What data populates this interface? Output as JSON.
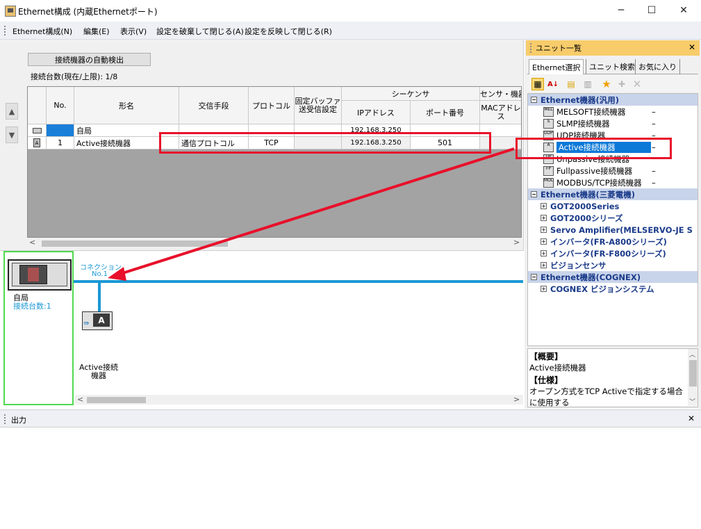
{
  "window": {
    "title": "Ethernet構成 (内蔵Ethernetポート)",
    "minimize": "─",
    "maximize": "☐",
    "close": "✕"
  },
  "menu": {
    "items": [
      "Ethernet構成(N)",
      "編集(E)",
      "表示(V)",
      "設定を破棄して閉じる(A)",
      "設定を反映して閉じる(R)"
    ]
  },
  "left": {
    "autodetect_label": "接続機器の自動検出",
    "count_label": "接続台数(現在/上限): 1/8",
    "up_arrow": "▲",
    "down_arrow": "▼",
    "table": {
      "headers": {
        "no": "No.",
        "model": "形名",
        "comm": "交信手段",
        "protocol": "プロトコル",
        "fixed_buffer_1": "固定バッファ",
        "fixed_buffer_2": "送受信設定",
        "sequencer": "シーケンサ",
        "sensor": "センサ・機器",
        "ip": "IPアドレス",
        "port": "ポート番号",
        "mac_1": "MACアドレ",
        "mac_2": "ス"
      },
      "rows": [
        {
          "no": "",
          "model": "自局",
          "comm": "",
          "protocol": "",
          "fixed": "",
          "ip": "192.168.3.250",
          "port": "",
          "mac": ""
        },
        {
          "no": "1",
          "model": "Active接続機器",
          "comm": "通信プロトコル",
          "protocol": "TCP",
          "fixed": "",
          "ip": "192.168.3.250",
          "port": "501",
          "mac": ""
        }
      ]
    },
    "scroll_left": "<",
    "scroll_right": ">"
  },
  "diagram": {
    "self_name": "自局",
    "self_count": "接続台数:1",
    "connection_label": "コネクション",
    "connection_no": "No.1",
    "device_label_1": "Active接続",
    "device_label_2": "機器",
    "device_letter": "A",
    "scroll_left": "<",
    "scroll_right": ">"
  },
  "unit_list": {
    "title": "ユニット一覧",
    "close": "✕",
    "tabs": [
      "Ethernet選択",
      "ユニット検索",
      "お気に入り"
    ],
    "tree": [
      {
        "type": "cat",
        "label": "Ethernet機器(汎用)",
        "expander": "⊟"
      },
      {
        "type": "dev",
        "icon": "MEL",
        "label": "MELSOFT接続機器",
        "dash": "–"
      },
      {
        "type": "dev",
        "icon": "S",
        "label": "SLMP接続機器",
        "dash": "–"
      },
      {
        "type": "dev",
        "icon": "UDP",
        "label": "UDP接続機器",
        "dash": "–"
      },
      {
        "type": "dev",
        "icon": "A",
        "label": "Active接続機器",
        "dash": "–",
        "selected": true
      },
      {
        "type": "dev",
        "icon": "UP",
        "label": "Unpassive接続機器",
        "dash": ""
      },
      {
        "type": "dev",
        "icon": "FP",
        "label": "Fullpassive接続機器",
        "dash": "–"
      },
      {
        "type": "dev",
        "icon": "MOD",
        "label": "MODBUS/TCP接続機器",
        "dash": "–"
      },
      {
        "type": "cat",
        "label": "Ethernet機器(三菱電機)",
        "expander": "⊟"
      },
      {
        "type": "sub",
        "label": "GOT2000Series",
        "expander": "⊞"
      },
      {
        "type": "sub",
        "label": "GOT2000シリーズ",
        "expander": "⊞"
      },
      {
        "type": "sub",
        "label": "Servo Amplifier(MELSERVO-JE S",
        "expander": "⊞"
      },
      {
        "type": "sub",
        "label": "インバータ(FR-A800シリーズ)",
        "expander": "⊞"
      },
      {
        "type": "sub",
        "label": "インバータ(FR-F800シリーズ)",
        "expander": "⊞"
      },
      {
        "type": "sub",
        "label": "ビジョンセンサ",
        "expander": "⊞"
      },
      {
        "type": "cat",
        "label": "Ethernet機器(COGNEX)",
        "expander": "⊟"
      },
      {
        "type": "sub",
        "label": "COGNEX ビジョンシステム",
        "expander": "⊞"
      }
    ],
    "desc": {
      "summary_head": "【概要】",
      "summary": "Active接続機器",
      "spec_head": "【仕様】",
      "spec_1": "オープン方式をTCP Activeで指定する場合",
      "spec_2": "に使用する"
    }
  },
  "output": {
    "title": "出力",
    "close": "✕"
  },
  "colors": {
    "accent_bus": "#1a98d5",
    "highlight_red": "#e8102a",
    "selection": "#0b78d7",
    "self_box": "#4fd94f"
  }
}
